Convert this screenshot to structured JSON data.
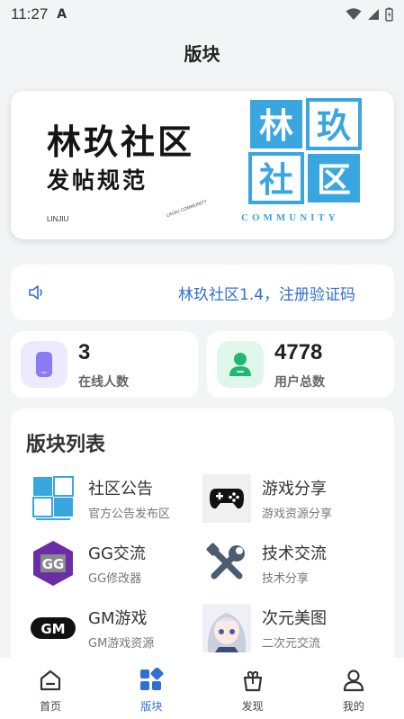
{
  "status_bar": {
    "time": "11:27",
    "app_glyph": "A"
  },
  "header": {
    "title": "版块"
  },
  "banner": {
    "title": "林玖社区",
    "subtitle": "发帖规范",
    "brand_small": "LINJIU",
    "logo_chars": [
      "林",
      "玖",
      "社",
      "区"
    ],
    "community": "COMMUNITY"
  },
  "notice": {
    "icon": "speaker-icon",
    "text": "林玖社区1.4，注册验证码"
  },
  "stats": [
    {
      "value": "3",
      "label": "在线人数",
      "icon": "phone-icon",
      "color": "#8b7cf6"
    },
    {
      "value": "4778",
      "label": "用户总数",
      "icon": "user-icon",
      "color": "#22b573"
    }
  ],
  "board": {
    "heading": "版块列表",
    "items": [
      {
        "name": "社区公告",
        "desc": "官方公告发布区",
        "icon": "linjiu-logo-icon"
      },
      {
        "name": "游戏分享",
        "desc": "游戏资源分享",
        "icon": "gamepad-icon"
      },
      {
        "name": "GG交流",
        "desc": "GG修改器",
        "icon": "gg-logo-icon"
      },
      {
        "name": "技术交流",
        "desc": "技术分享",
        "icon": "tools-icon"
      },
      {
        "name": "GM游戏",
        "desc": "GM游戏资源",
        "icon": "gm-logo-icon"
      },
      {
        "name": "次元美图",
        "desc": "二次元交流",
        "icon": "anime-avatar-icon"
      }
    ]
  },
  "tabbar": {
    "items": [
      {
        "label": "首页",
        "icon": "home-icon"
      },
      {
        "label": "版块",
        "icon": "grid-icon",
        "active": true
      },
      {
        "label": "发现",
        "icon": "gift-icon"
      },
      {
        "label": "我的",
        "icon": "profile-icon"
      }
    ]
  },
  "colors": {
    "accent": "#2f6fd6",
    "logo_blue": "#3aa6e0"
  }
}
